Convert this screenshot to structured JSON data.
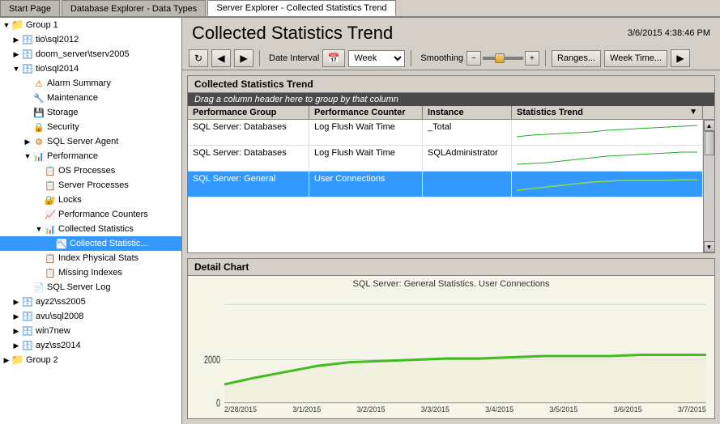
{
  "tabs": [
    {
      "label": "Start Page",
      "active": false
    },
    {
      "label": "Database Explorer - Data Types",
      "active": false
    },
    {
      "label": "Server Explorer - Collected Statistics Trend",
      "active": true
    }
  ],
  "tree": {
    "groups": [
      {
        "label": "Group 1",
        "expanded": true,
        "servers": [
          {
            "label": "tio\\sql2012",
            "expanded": false,
            "children": []
          },
          {
            "label": "doom_server\\tserv2005",
            "expanded": false,
            "children": []
          },
          {
            "label": "tio\\sql2014",
            "expanded": true,
            "children": [
              {
                "label": "Alarm Summary",
                "icon": "alarm",
                "indent": 3
              },
              {
                "label": "Maintenance",
                "icon": "wrench",
                "indent": 3
              },
              {
                "label": "Storage",
                "icon": "storage",
                "indent": 3
              },
              {
                "label": "Security",
                "icon": "security",
                "indent": 3
              },
              {
                "label": "SQL Server Agent",
                "icon": "agent",
                "indent": 3
              },
              {
                "label": "Performance",
                "icon": "perf",
                "indent": 3,
                "expanded": true,
                "children": [
                  {
                    "label": "OS Processes",
                    "icon": "proc",
                    "indent": 4
                  },
                  {
                    "label": "Server Processes",
                    "icon": "proc",
                    "indent": 4
                  },
                  {
                    "label": "Locks",
                    "icon": "lock",
                    "indent": 4
                  },
                  {
                    "label": "Performance Counters",
                    "icon": "counter",
                    "indent": 4
                  },
                  {
                    "label": "Collected Statistics",
                    "icon": "stats",
                    "indent": 4,
                    "expanded": true,
                    "children": [
                      {
                        "label": "Collected Statistic...",
                        "icon": "chart",
                        "indent": 5,
                        "selected": true
                      }
                    ]
                  },
                  {
                    "label": "Index Physical Stats",
                    "icon": "index",
                    "indent": 4
                  },
                  {
                    "label": "Missing Indexes",
                    "icon": "missing",
                    "indent": 4
                  }
                ]
              }
            ]
          },
          {
            "label": "SQL Server Log",
            "icon": "log",
            "indent": 3
          }
        ]
      }
    ],
    "otherServers": [
      {
        "label": "ayz2\\ss2005",
        "indent": 1
      },
      {
        "label": "avu\\sql2008",
        "indent": 1
      },
      {
        "label": "win7new",
        "indent": 1
      },
      {
        "label": "ayz\\ss2014",
        "indent": 1
      }
    ],
    "group2": {
      "label": "Group 2"
    }
  },
  "header": {
    "title": "Collected Statistics Trend",
    "datetime": "3/6/2015 4:38:46 PM"
  },
  "toolbar": {
    "date_interval_label": "Date Interval",
    "week_option": "Week",
    "smoothing_label": "Smoothing",
    "ranges_label": "Ranges...",
    "week_time_label": "Week Time..."
  },
  "grid": {
    "title": "Collected Statistics Trend",
    "drag_hint": "Drag a column header here to group by that column",
    "columns": [
      "Performance Group",
      "Performance Counter",
      "Instance",
      "Statistics Trend"
    ],
    "rows": [
      {
        "perf_group": "SQL Server: Databases",
        "perf_counter": "Log Flush Wait Time",
        "instance": "_Total",
        "selected": false
      },
      {
        "perf_group": "SQL Server: Databases",
        "perf_counter": "Log Flush Wait Time",
        "instance": "SQLAdministrator",
        "selected": false
      },
      {
        "perf_group": "SQL Server: General",
        "perf_counter": "User Connections",
        "instance": "",
        "selected": true
      }
    ]
  },
  "detail_chart": {
    "title": "Detail Chart",
    "chart_title": "SQL Server: General Statistics. User Connections",
    "y_labels": [
      "2000",
      "0"
    ],
    "x_labels": [
      "2/28/2015",
      "3/1/2015",
      "3/2/2015",
      "3/3/2015",
      "3/4/2015",
      "3/5/2015",
      "3/6/2015",
      "3/7/2015"
    ]
  }
}
